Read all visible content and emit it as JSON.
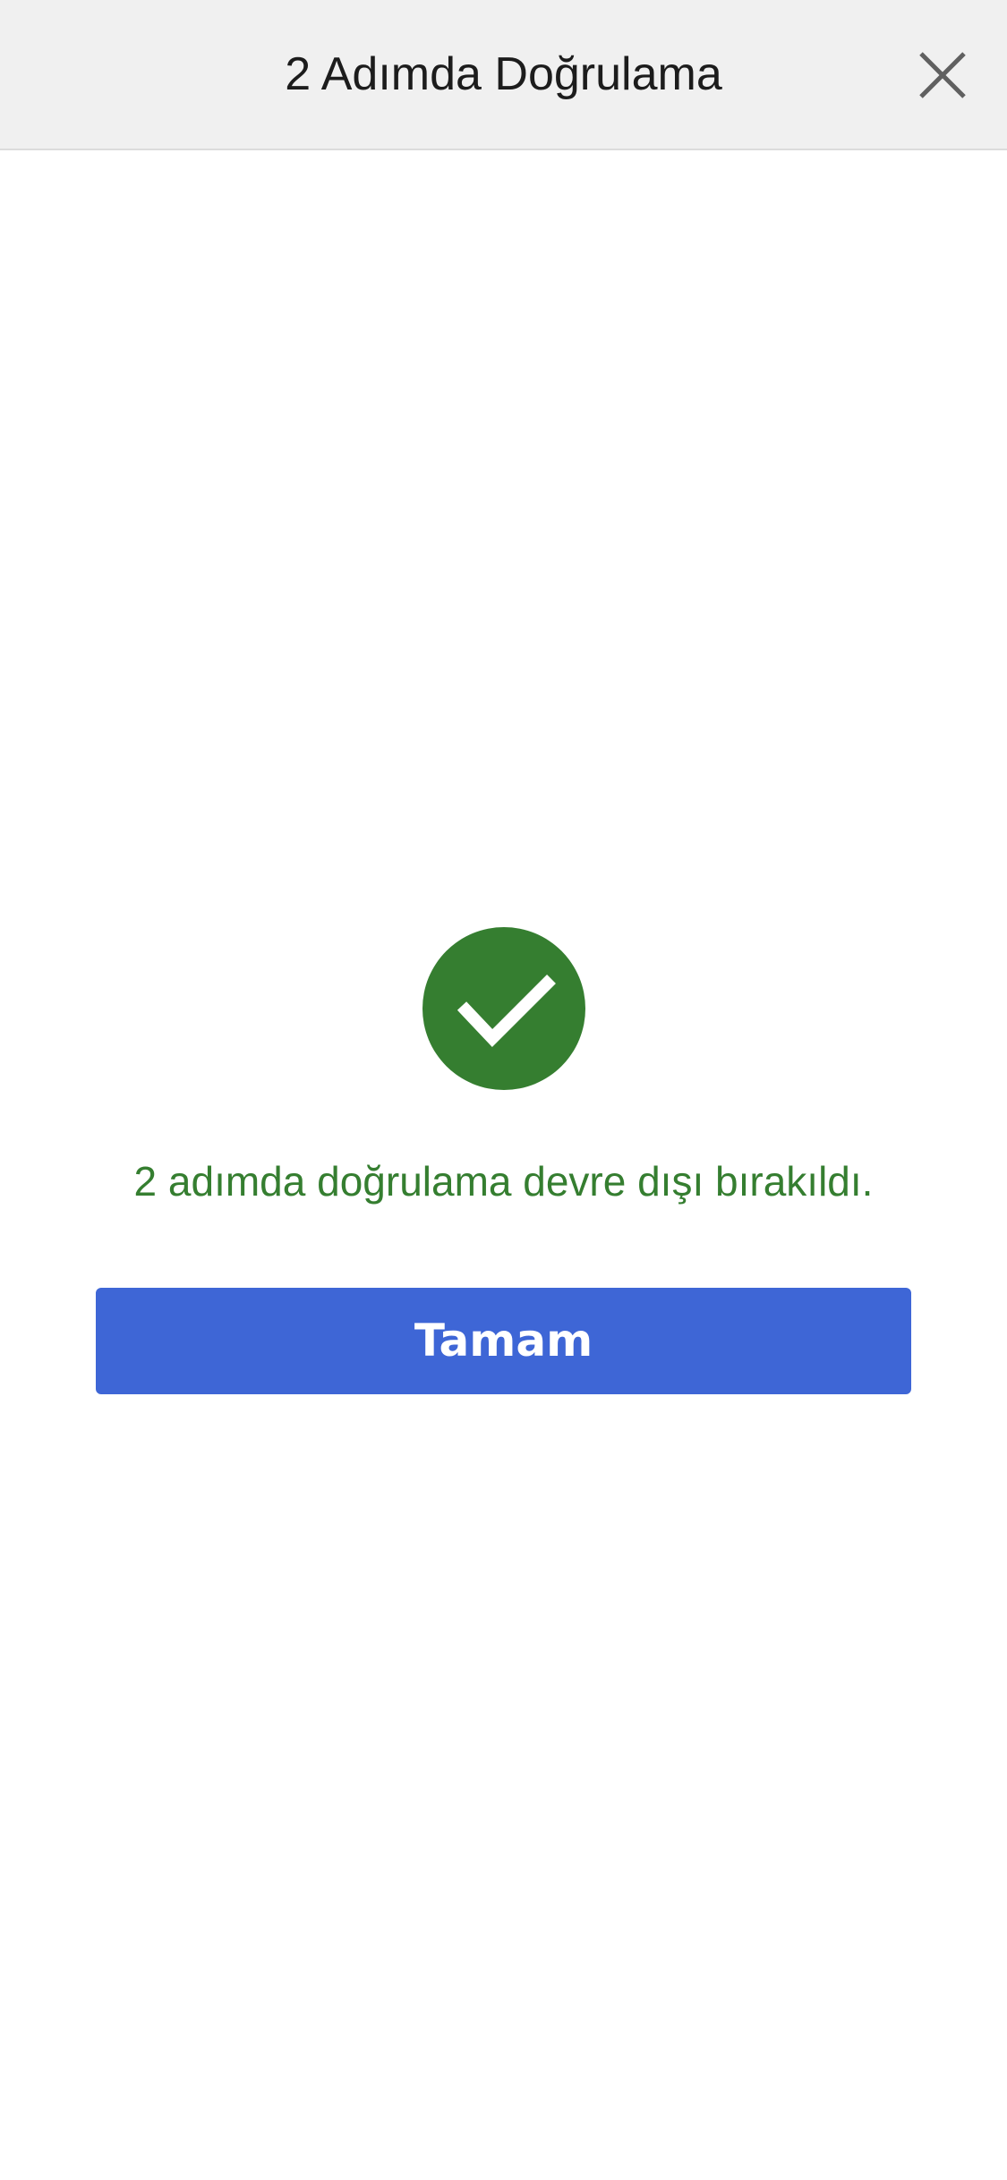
{
  "header": {
    "title": "2 Adımda Doğrulama",
    "close_icon": "close-icon"
  },
  "main": {
    "status_icon": "checkmark-circle-icon",
    "message": "2 adımda doğrulama devre dışı bırakıldı.",
    "ok_button_label": "Tamam"
  },
  "colors": {
    "success": "#357e30",
    "primary": "#3e66d6",
    "header_bg": "#f0f0f0",
    "close_icon": "#606060"
  }
}
